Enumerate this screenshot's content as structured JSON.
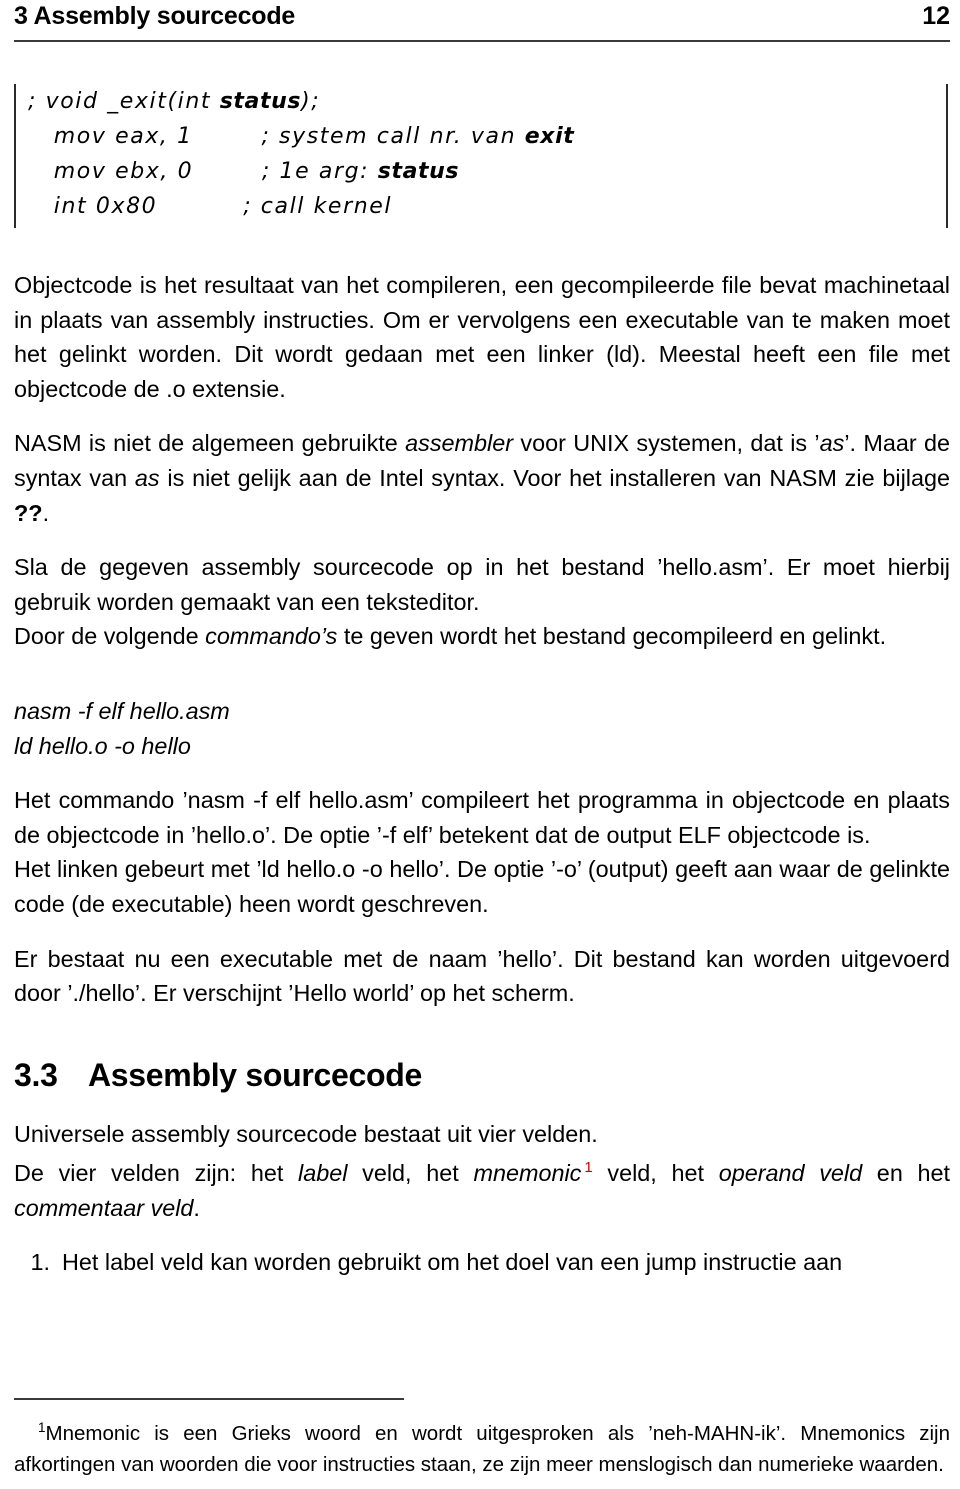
{
  "header": {
    "title": "3 Assembly sourcecode",
    "page_number": "12"
  },
  "code_block": {
    "lines": [
      [
        {
          "t": "; void _exit(int ",
          "b": false
        },
        {
          "t": "status",
          "b": true
        },
        {
          "t": ");",
          "b": false
        }
      ],
      [
        {
          "t": "   mov eax, 1        ; system call nr. van ",
          "b": false
        },
        {
          "t": "exit",
          "b": true
        }
      ],
      [
        {
          "t": "   mov ebx, 0        ; 1e arg: ",
          "b": false
        },
        {
          "t": "status",
          "b": true
        }
      ],
      [
        {
          "t": "   int 0x80          ; call kernel",
          "b": false
        }
      ]
    ]
  },
  "body": {
    "p1": "Objectcode is het resultaat van het compileren, een gecompileerde file bevat ma­chinetaal in plaats van assembly instructies. Om er vervolgens een executable van te maken moet het gelinkt worden.  Dit wordt gedaan met een linker (ld).  Meestal heeft een file met objectcode de .o extensie.",
    "p2_a": "NASM is niet de algemeen gebruikte ",
    "p2_i1": "assembler",
    "p2_b": " voor UNIX systemen, dat is ’",
    "p2_i2": "as",
    "p2_c": "’. Maar de syntax van ",
    "p2_i3": "as",
    "p2_d": " is niet gelijk aan de Intel syntax.  Voor het installeren van NASM zie bijlage ",
    "p2_bold": "??",
    "p2_e": ".",
    "p3": "Sla de gegeven assembly sourcecode op in het bestand ’hello.asm’. Er moet hier­bij gebruik worden gemaakt van een teksteditor.",
    "p4_a": "Door de volgende ",
    "p4_i1": "commando’s",
    "p4_b": " te geven wordt het bestand gecompileerd en gel­inkt.",
    "cmd1": "nasm -f elf hello.asm",
    "cmd2": "ld hello.o -o hello",
    "p5": "Het commando ’nasm -f elf hello.asm’ compileert het programma in objectcode en plaats de objectcode in ’hello.o’.  De optie ’-f elf’ betekent dat de output ELF ob­jectcode is.",
    "p6": "Het linken gebeurt met ’ld hello.o -o hello’. De optie ’-o’ (output) geeft aan waar de gelinkte code (de executable) heen wordt geschreven.",
    "p7": "Er bestaat nu een executable met de naam ’hello’.  Dit bestand kan worden uitge­voerd door ’./hello’. Er verschijnt ’Hello world’ op het scherm."
  },
  "section": {
    "number": "3.3",
    "title": "Assembly sourcecode"
  },
  "fields": {
    "intro": "Universele assembly sourcecode bestaat uit vier velden.",
    "line2_a": "De vier velden zijn: het ",
    "line2_i1": "label",
    "line2_b": " veld, het ",
    "line2_i2": "mnemonic",
    "line2_footnote_mark": "1",
    "line2_c": " veld, het ",
    "line2_i3": "operand veld",
    "line2_d": " en het ",
    "line2_i4": "commentaar veld",
    "line2_e": "."
  },
  "list": {
    "items": [
      {
        "marker": "1.",
        "text": "Het label veld kan worden gebruikt om het doel van een jump instructie aan"
      }
    ]
  },
  "footnote": {
    "mark": "1",
    "text": "Mnemonic is een Grieks woord en wordt uitgesproken als ’neh-MAHN-ik’.   Mnemonics zijn afkortingen van woorden die voor instructies staan, ze zijn meer menslogisch dan numerieke waar­den."
  },
  "colors": {
    "text": "#000000",
    "rule": "#3a3a3a",
    "footnote_mark": "#cc0000",
    "background": "#ffffff"
  }
}
